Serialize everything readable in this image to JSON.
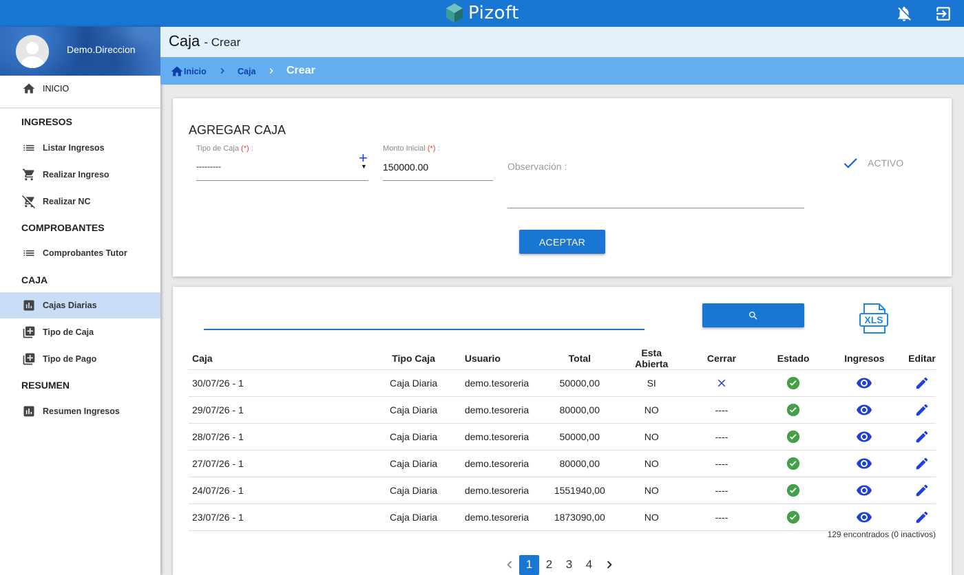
{
  "app": {
    "brand": "Pizoft"
  },
  "user": {
    "name": "Demo.Direccion"
  },
  "sidebar": {
    "home": "INICIO",
    "sections": {
      "ingresos": "INGRESOS",
      "comprobantes": "COMPROBANTES",
      "caja": "CAJA",
      "resumen": "RESUMEN"
    },
    "items": {
      "listar_ingresos": "Listar Ingresos",
      "realizar_ingreso": "Realizar Ingreso",
      "realizar_nc": "Realizar NC",
      "comprobantes_tutor": "Comprobantes Tutor",
      "cajas_diarias": "Cajas Diarias",
      "tipo_caja": "Tipo de Caja",
      "tipo_pago": "Tipo de Pago",
      "resumen_ingresos": "Resumen Ingresos"
    }
  },
  "header": {
    "title": "Caja",
    "subtitle": "- Crear"
  },
  "breadcrumb": {
    "home": "Inicio",
    "caja": "Caja",
    "current": "Crear"
  },
  "form": {
    "title": "AGREGAR CAJA",
    "tipo_caja_label": "Tipo de Caja ",
    "tipo_caja_suffix": " :",
    "required_mark": "(*)",
    "tipo_caja_value": "---------",
    "monto_label": "Monto Inicial ",
    "monto_suffix": " :",
    "monto_value": "150000.00",
    "observacion_label": "Observación :",
    "activo_label": "ACTIVO",
    "submit": "ACEPTAR"
  },
  "table": {
    "headers": [
      "Caja",
      "Tipo Caja",
      "Usuario",
      "Total",
      "Esta Abierta",
      "Cerrar",
      "Estado",
      "Ingresos",
      "Editar"
    ],
    "rows": [
      {
        "caja": "30/07/26 - 1",
        "tipo": "Caja Diaria",
        "usuario": "demo.tesoreria",
        "total": "50000,00",
        "abierta": "SI",
        "cerrar": ""
      },
      {
        "caja": "29/07/26 - 1",
        "tipo": "Caja Diaria",
        "usuario": "demo.tesoreria",
        "total": "80000,00",
        "abierta": "NO",
        "cerrar": "----"
      },
      {
        "caja": "28/07/26 - 1",
        "tipo": "Caja Diaria",
        "usuario": "demo.tesoreria",
        "total": "50000,00",
        "abierta": "NO",
        "cerrar": "----"
      },
      {
        "caja": "27/07/26 - 1",
        "tipo": "Caja Diaria",
        "usuario": "demo.tesoreria",
        "total": "80000,00",
        "abierta": "NO",
        "cerrar": "----"
      },
      {
        "caja": "24/07/26 - 1",
        "tipo": "Caja Diaria",
        "usuario": "demo.tesoreria",
        "total": "1551940,00",
        "abierta": "NO",
        "cerrar": "----"
      },
      {
        "caja": "23/07/26 - 1",
        "tipo": "Caja Diaria",
        "usuario": "demo.tesoreria",
        "total": "1873090,00",
        "abierta": "NO",
        "cerrar": "----"
      }
    ],
    "found": "129 encontrados (0 inactivos)",
    "xls_label": "XLS"
  },
  "pagination": {
    "pages": [
      "1",
      "2",
      "3",
      "4"
    ],
    "current": "1"
  },
  "colors": {
    "primary": "#1976d2",
    "estado_ok": "#43a047",
    "icon_blue": "#1e40d6"
  }
}
